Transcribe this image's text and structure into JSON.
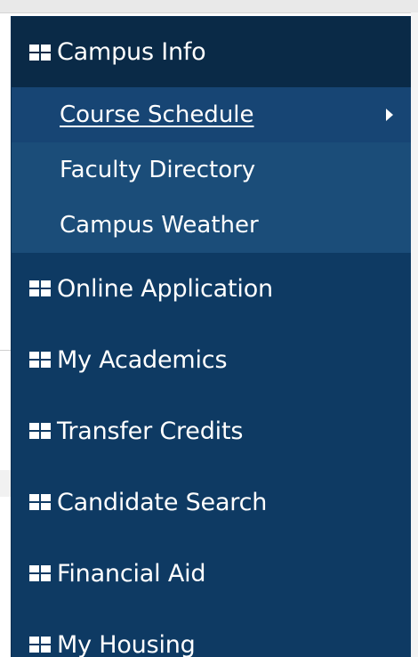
{
  "menu": {
    "header_item": {
      "label": "Campus Info",
      "icon": "grid-icon"
    },
    "submenu": [
      {
        "label": "Course Schedule",
        "active": true,
        "has_children": true
      },
      {
        "label": "Faculty Directory",
        "active": false,
        "has_children": false
      },
      {
        "label": "Campus Weather",
        "active": false,
        "has_children": false
      }
    ],
    "items": [
      {
        "label": "Online Application",
        "icon": "grid-icon"
      },
      {
        "label": "My Academics",
        "icon": "grid-icon"
      },
      {
        "label": "Transfer Credits",
        "icon": "grid-icon"
      },
      {
        "label": "Candidate Search",
        "icon": "grid-icon"
      },
      {
        "label": "Financial Aid",
        "icon": "grid-icon"
      },
      {
        "label": "My Housing",
        "icon": "grid-icon"
      }
    ]
  },
  "colors": {
    "menu_bg": "#0e3a63",
    "header_bg": "#0a2a47",
    "submenu_bg": "#1b4d79",
    "active_sub_bg": "#174574",
    "text": "#ffffff"
  }
}
